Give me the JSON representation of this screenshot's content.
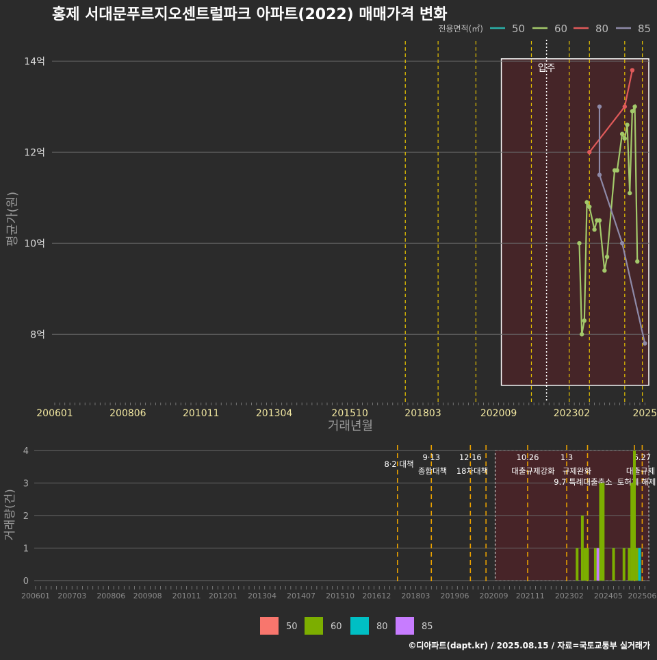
{
  "title": "홍제 서대문푸르지오센트럴파크 아파트(2022) 매매가격 변화",
  "footer": "©디아파트(dapt.kr) / 2025.08.15 / 자료=국토교통부 실거래가",
  "colors": {
    "bg": "#2b2b2b",
    "s50": "#f8766d",
    "s60": "#a3c96a",
    "s80": "#e05a5a",
    "s85": "#8e8aa8",
    "b50": "#f8766d",
    "b60": "#7cae00",
    "b80": "#00bfc4",
    "b85": "#c77cff",
    "policy": "#e8c400",
    "shade": "#4a2428"
  },
  "chart_data": [
    {
      "type": "line",
      "xlabel": "거래년월",
      "ylabel": "평균가(원)",
      "legend_title": "전용면적(㎡)",
      "legend_position": "top-right",
      "x_ticks": [
        "200601",
        "200806",
        "201011",
        "201304",
        "201510",
        "201803",
        "202009",
        "202302",
        "2025"
      ],
      "y_ticks": [
        "8억",
        "10억",
        "12억",
        "14억"
      ],
      "ylim_eok": [
        6.5,
        14.5
      ],
      "annotation": "입주",
      "series": [
        {
          "name": "50",
          "points": []
        },
        {
          "name": "60",
          "points": [
            [
              "2023-05",
              10.0
            ],
            [
              "2023-06",
              8.0
            ],
            [
              "2023-07",
              8.3
            ],
            [
              "2023-08",
              10.9
            ],
            [
              "2023-09",
              10.8
            ],
            [
              "2023-11",
              10.3
            ],
            [
              "2023-12",
              10.5
            ],
            [
              "2024-01",
              10.5
            ],
            [
              "2024-03",
              9.4
            ],
            [
              "2024-04",
              9.7
            ],
            [
              "2024-07",
              11.6
            ],
            [
              "2024-08",
              11.6
            ],
            [
              "2024-10",
              12.4
            ],
            [
              "2024-11",
              12.3
            ],
            [
              "2024-12",
              12.6
            ],
            [
              "2025-01",
              11.1
            ],
            [
              "2025-02",
              12.9
            ],
            [
              "2025-03",
              13.0
            ],
            [
              "2025-04",
              9.6
            ]
          ]
        },
        {
          "name": "80",
          "points": [
            [
              "2023-09",
              12.0
            ],
            [
              "2024-11",
              13.0
            ],
            [
              "2025-02",
              13.8
            ]
          ]
        },
        {
          "name": "85",
          "points": [
            [
              "2024-01",
              13.0
            ],
            [
              "2024-01",
              11.5
            ],
            [
              "2024-10",
              10.0
            ],
            [
              "2025-07",
              7.8
            ]
          ]
        }
      ]
    },
    {
      "type": "bar",
      "ylabel": "거래량(건)",
      "ylim": [
        0,
        4
      ],
      "y_ticks": [
        "0",
        "1",
        "2",
        "3",
        "4"
      ],
      "x_ticks": [
        "200601",
        "200703",
        "200806",
        "200908",
        "201011",
        "201201",
        "201304",
        "201407",
        "201510",
        "201612",
        "201803",
        "201906",
        "202009",
        "202111",
        "202302",
        "202405",
        "202506"
      ],
      "legend": [
        "50",
        "60",
        "80",
        "85"
      ],
      "policy_labels": [
        {
          "date": "2017-08",
          "top": "",
          "bottom": "8·2 대책"
        },
        {
          "date": "2018-09",
          "top": "9·13",
          "bottom": "종합대책"
        },
        {
          "date": "2019-12",
          "top": "12·16",
          "bottom": "18차대책"
        },
        {
          "date": "2021-10",
          "top": "10.26",
          "bottom": "대출규제강화"
        },
        {
          "date": "2023-01",
          "top": "1.3",
          "bottom": "규제완화"
        },
        {
          "date": "2023-09",
          "top": "",
          "bottom": "9.7 특례대출축소"
        },
        {
          "date": "2025-06",
          "top": "6.27",
          "bottom": "대출규제"
        },
        {
          "date": "2025-03",
          "top": "",
          "bottom": "토허제 해제"
        }
      ],
      "bars": [
        {
          "date": "2023-05",
          "s": "60",
          "v": 1
        },
        {
          "date": "2023-07",
          "s": "60",
          "v": 2
        },
        {
          "date": "2023-08",
          "s": "60",
          "v": 1
        },
        {
          "date": "2023-09",
          "s": "60",
          "v": 1
        },
        {
          "date": "2023-12",
          "s": "60",
          "v": 1
        },
        {
          "date": "2024-01",
          "s": "60",
          "v": 1
        },
        {
          "date": "2024-01",
          "s": "85",
          "v": 1
        },
        {
          "date": "2024-02",
          "s": "60",
          "v": 3
        },
        {
          "date": "2024-03",
          "s": "60",
          "v": 3
        },
        {
          "date": "2024-07",
          "s": "60",
          "v": 1
        },
        {
          "date": "2024-11",
          "s": "60",
          "v": 1
        },
        {
          "date": "2025-01",
          "s": "60",
          "v": 1
        },
        {
          "date": "2025-02",
          "s": "60",
          "v": 3
        },
        {
          "date": "2025-03",
          "s": "60",
          "v": 4
        },
        {
          "date": "2025-04",
          "s": "60",
          "v": 1
        },
        {
          "date": "2025-05",
          "s": "80",
          "v": 1
        }
      ]
    }
  ]
}
